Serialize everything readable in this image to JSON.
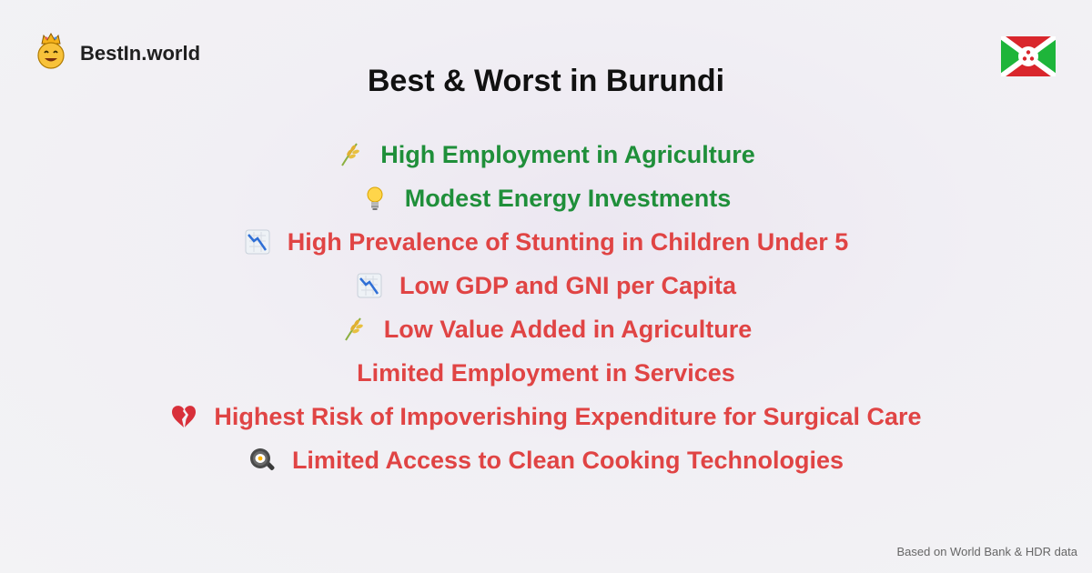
{
  "brand": {
    "name": "BestIn.world",
    "logo_icon": "crowned-smiley-icon"
  },
  "header": {
    "title": "Best & Worst in Burundi",
    "flag_icon": "burundi-flag-icon"
  },
  "items": [
    {
      "label": "High Employment in Agriculture",
      "icon": "sheaf-of-rice-icon",
      "status": "good",
      "color": "#1f8f3a"
    },
    {
      "label": "Modest Energy Investments",
      "icon": "light-bulb-icon",
      "status": "good",
      "color": "#1f8f3a"
    },
    {
      "label": "High Prevalence of Stunting in Children Under 5",
      "icon": "chart-decreasing-icon",
      "status": "bad",
      "color": "#e04444"
    },
    {
      "label": "Low GDP and GNI per Capita",
      "icon": "chart-decreasing-icon",
      "status": "bad",
      "color": "#e04444"
    },
    {
      "label": "Low Value Added in Agriculture",
      "icon": "sheaf-of-rice-icon",
      "status": "bad",
      "color": "#e04444"
    },
    {
      "label": "Limited Employment in Services",
      "icon": "",
      "status": "bad",
      "color": "#e04444"
    },
    {
      "label": "Highest Risk of Impoverishing Expenditure for Surgical Care",
      "icon": "broken-heart-icon",
      "status": "bad",
      "color": "#e04444"
    },
    {
      "label": "Limited Access to Clean Cooking Technologies",
      "icon": "frying-pan-icon",
      "status": "bad",
      "color": "#e04444"
    }
  ],
  "footer": {
    "source": "Based on World Bank & HDR data"
  }
}
